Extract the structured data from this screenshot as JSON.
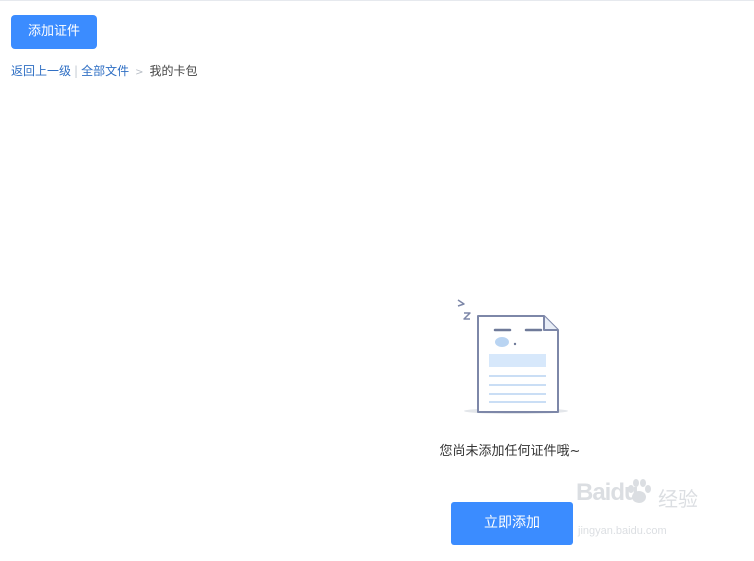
{
  "toolbar": {
    "add_cert_label": "添加证件"
  },
  "breadcrumb": {
    "back_label": "返回上一级",
    "separator": "|",
    "all_files_label": "全部文件",
    "arrow": ">",
    "current_label": "我的卡包"
  },
  "empty_state": {
    "message": "您尚未添加任何证件哦~",
    "add_now_label": "立即添加",
    "illustration_icon": "sleeping-document-icon",
    "sleep_marks": "z"
  },
  "watermark": {
    "brand": "Baidu",
    "brand_suffix": "经验",
    "url": "jingyan.baidu.com"
  },
  "colors": {
    "primary": "#3b8cff",
    "link": "#2f6fc4",
    "text": "#333333"
  }
}
